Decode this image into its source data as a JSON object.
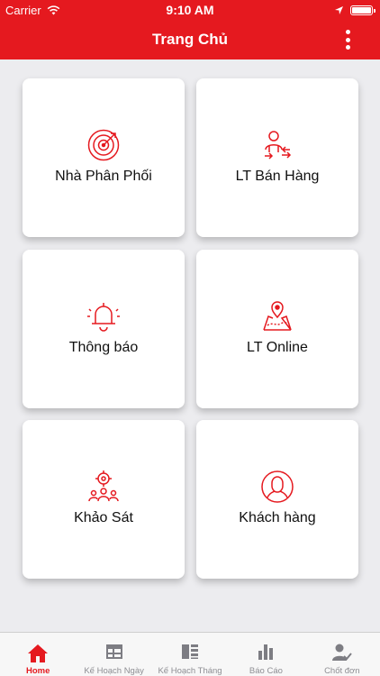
{
  "status_bar": {
    "carrier": "Carrier",
    "time": "9:10 AM"
  },
  "nav": {
    "title": "Trang Chủ",
    "menu_icon": "more-vertical-icon"
  },
  "colors": {
    "brand": "#e5191f",
    "tab_inactive": "#8e8e93",
    "background": "#ececef"
  },
  "cards": [
    {
      "label": "Nhà Phân Phối",
      "icon": "radar-target-icon"
    },
    {
      "label": "LT Bán Hàng",
      "icon": "salesman-route-icon"
    },
    {
      "label": "Thông báo",
      "icon": "bell-icon"
    },
    {
      "label": "LT Online",
      "icon": "map-pin-icon"
    },
    {
      "label": "Khảo Sát",
      "icon": "survey-target-group-icon"
    },
    {
      "label": "Khách hàng",
      "icon": "customer-avatar-icon"
    }
  ],
  "tabs": [
    {
      "label": "Home",
      "icon": "home-icon",
      "active": true
    },
    {
      "label": "Kế Hoạch Ngày",
      "icon": "daily-plan-icon",
      "active": false
    },
    {
      "label": "Kế Hoạch Tháng",
      "icon": "monthly-plan-icon",
      "active": false
    },
    {
      "label": "Báo Cáo",
      "icon": "bar-chart-icon",
      "active": false
    },
    {
      "label": "Chốt đơn",
      "icon": "user-check-icon",
      "active": false
    }
  ]
}
